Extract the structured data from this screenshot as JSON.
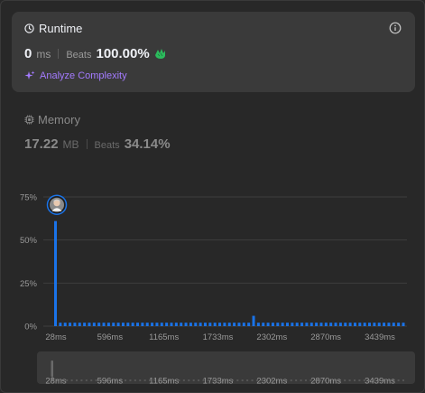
{
  "runtime": {
    "title": "Runtime",
    "value": "0",
    "unit": "ms",
    "beats_label": "Beats",
    "beats_value": "100.00%",
    "analyze_label": "Analyze Complexity"
  },
  "memory": {
    "title": "Memory",
    "value": "17.22",
    "unit": "MB",
    "beats_label": "Beats",
    "beats_value": "34.14%"
  },
  "colors": {
    "bar": "#1a73e8",
    "accent_purple": "#a47bff",
    "hands_green": "#2cbb5d"
  },
  "chart_data": {
    "type": "bar",
    "ylim": [
      0,
      75
    ],
    "y_ticks": [
      "0%",
      "25%",
      "50%",
      "75%"
    ],
    "x_tick_labels": [
      "28ms",
      "596ms",
      "1165ms",
      "1733ms",
      "2302ms",
      "2870ms",
      "3439ms"
    ],
    "values": [
      61,
      2,
      2,
      2,
      2,
      2,
      2,
      2,
      2,
      2,
      2,
      2,
      2,
      2,
      2,
      2,
      2,
      2,
      2,
      2,
      2,
      2,
      2,
      2,
      2,
      2,
      2,
      2,
      2,
      2,
      2,
      2,
      2,
      2,
      2,
      2,
      2,
      2,
      2,
      2,
      2,
      6,
      2,
      2,
      2,
      2,
      2,
      2,
      2,
      2,
      2,
      2,
      2,
      2,
      2,
      2,
      2,
      2,
      2,
      2,
      2,
      2,
      2,
      2,
      2,
      2,
      2,
      2,
      2,
      2,
      2,
      2,
      2
    ],
    "highlight_index": 0,
    "grid": true
  },
  "range_slider": {
    "tick_labels": [
      "28ms",
      "596ms",
      "1165ms",
      "1733ms",
      "2302ms",
      "2870ms",
      "3439ms"
    ]
  }
}
